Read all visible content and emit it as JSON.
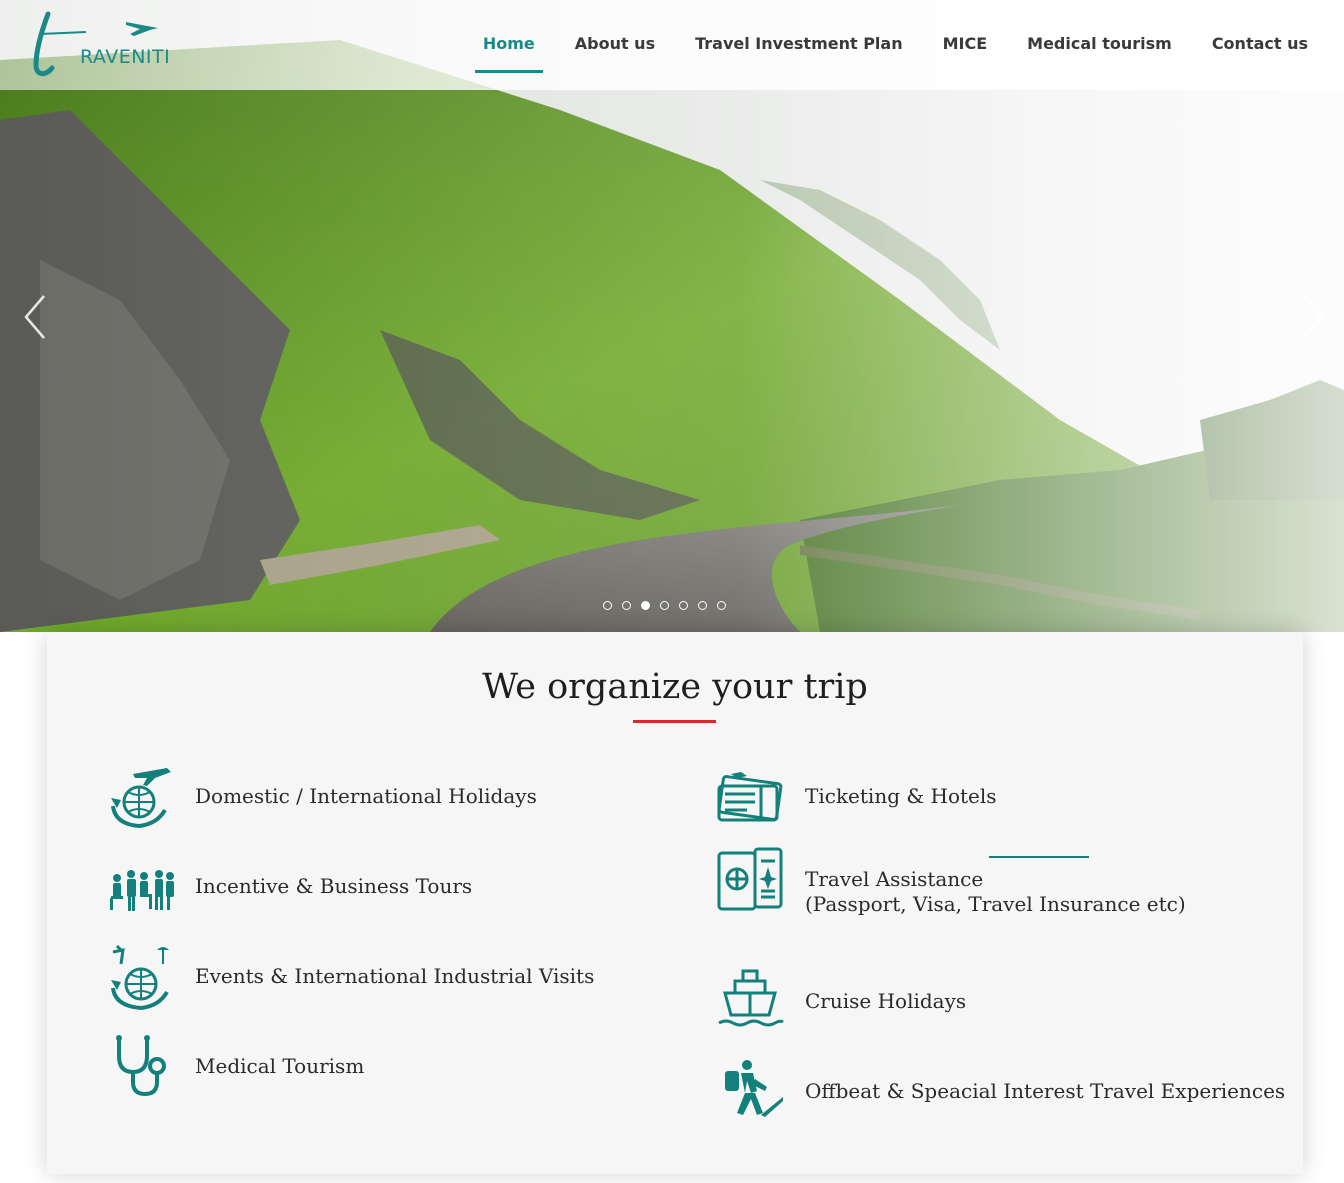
{
  "brand": {
    "logo_text": "RAVENITI",
    "logo_letter": "t"
  },
  "nav": {
    "items": [
      {
        "label": "Home",
        "active": true
      },
      {
        "label": "About us"
      },
      {
        "label": "Travel Investment Plan"
      },
      {
        "label": "MICE"
      },
      {
        "label": "Medical tourism"
      },
      {
        "label": "Contact us"
      }
    ]
  },
  "carousel": {
    "slide_count": 7,
    "active_slide": 3
  },
  "services": {
    "title": "We organize your trip",
    "left": [
      {
        "label": "Domestic / International Holidays",
        "icon": "plane-globe-icon"
      },
      {
        "label": "Incentive & Business Tours",
        "icon": "business-group-icon"
      },
      {
        "label": "Events & International Industrial Visits",
        "icon": "events-globe-icon"
      },
      {
        "label": "Medical Tourism",
        "icon": "stethoscope-icon"
      }
    ],
    "right": [
      {
        "label": "Ticketing & Hotels",
        "icon": "tickets-icon"
      },
      {
        "label": "Travel Assistance",
        "label2": "(Passport, Visa, Travel Insurance etc)",
        "icon": "passport-icon"
      },
      {
        "label": "Cruise Holidays",
        "icon": "ship-icon"
      },
      {
        "label": "Offbeat & Speacial Interest Travel Experiences",
        "icon": "hiker-icon"
      }
    ]
  },
  "colors": {
    "accent": "#1b8a86",
    "title_underline": "#d42a2a",
    "nav_text": "#3a3a3a"
  }
}
